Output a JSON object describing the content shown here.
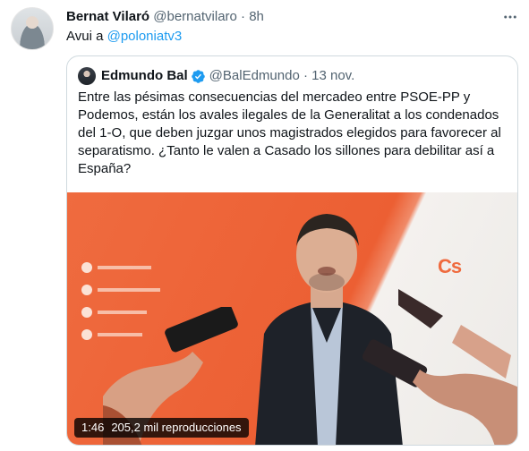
{
  "tweet": {
    "author_name": "Bernat Vilaró",
    "author_handle": "@bernatvilaro",
    "separator": "·",
    "time": "8h",
    "text_prefix": "Avui a ",
    "mention": "@poloniatv3"
  },
  "quote": {
    "author_name": "Edmundo Bal",
    "author_handle": "@BalEdmundo",
    "separator": "·",
    "time": "13 nov.",
    "text": "Entre las pésimas consecuencias del mercadeo entre PSOE-PP y Podemos, están los avales ilegales de la Generalitat a los condenados del 1-O, que deben juzgar unos magistrados elegidos para favorecer al separatismo. ¿Tanto le valen a Casado los sillones para debilitar así a España?",
    "video": {
      "duration": "1:46",
      "views": "205,2 mil reproducciones"
    }
  },
  "colors": {
    "accent": "#1d9bf0",
    "verified": "#1d9bf0",
    "backdrop_orange": "#ec5f33"
  },
  "icons": {
    "more": "more-horizontal-icon",
    "verified": "verified-badge-icon"
  }
}
